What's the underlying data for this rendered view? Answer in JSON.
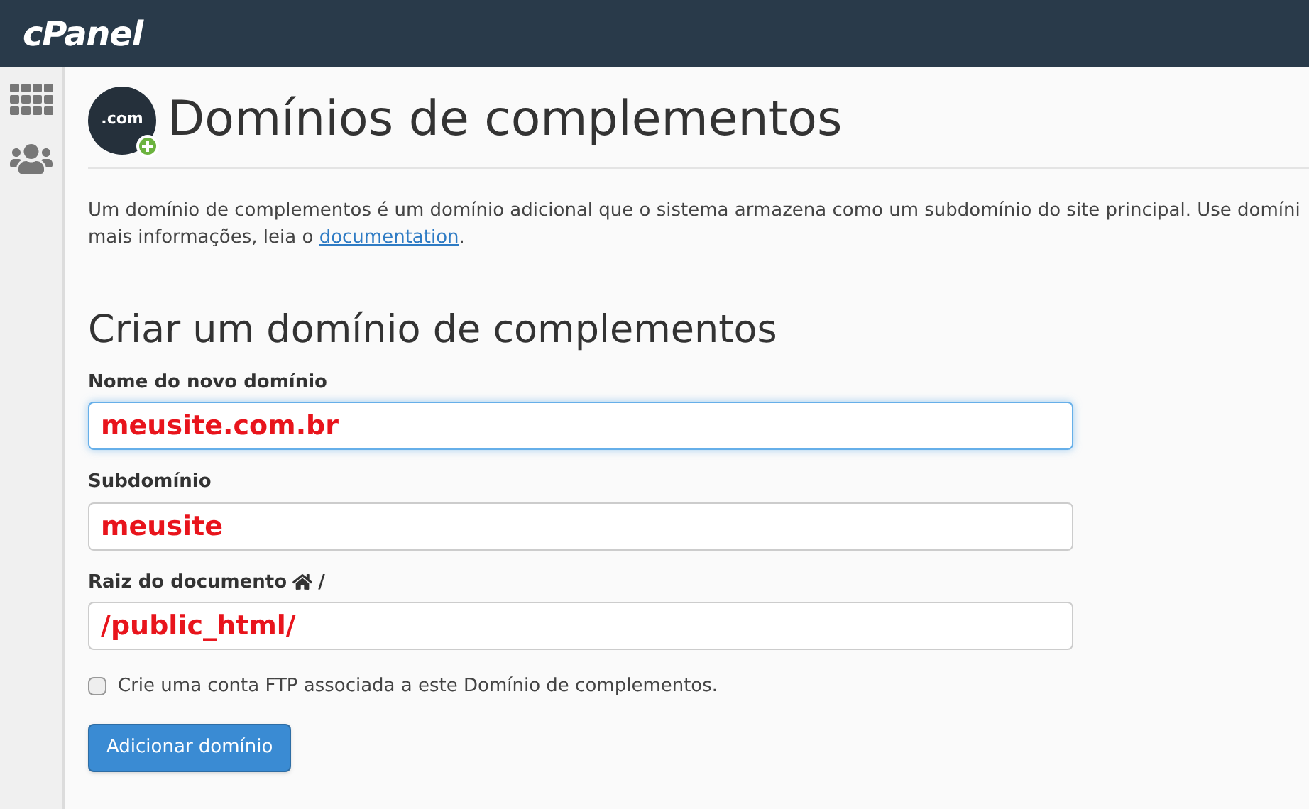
{
  "header": {
    "logo": "cPanel"
  },
  "page": {
    "icon_text": ".com",
    "title": "Domínios de complementos",
    "description_line_1": "Um domínio de complementos é um domínio adicional que o sistema armazena como um subdomínio do site principal. Use domíni",
    "description_prefix": "mais informações, leia o ",
    "description_link": "documentation",
    "description_suffix": "."
  },
  "form": {
    "heading": "Criar um domínio de complementos",
    "fields": [
      {
        "label": "Nome do novo domínio",
        "value": "meusite.com.br",
        "focused": true,
        "home_icon": false
      },
      {
        "label": "Subdomínio",
        "value": "meusite",
        "focused": false,
        "home_icon": false
      },
      {
        "label": "Raiz do documento",
        "label_suffix": "/",
        "value": "/public_html/",
        "focused": false,
        "home_icon": true
      }
    ],
    "checkbox": {
      "label": "Crie uma conta FTP associada a este Domínio de complementos.",
      "checked": false
    },
    "submit": "Adicionar domínio"
  }
}
